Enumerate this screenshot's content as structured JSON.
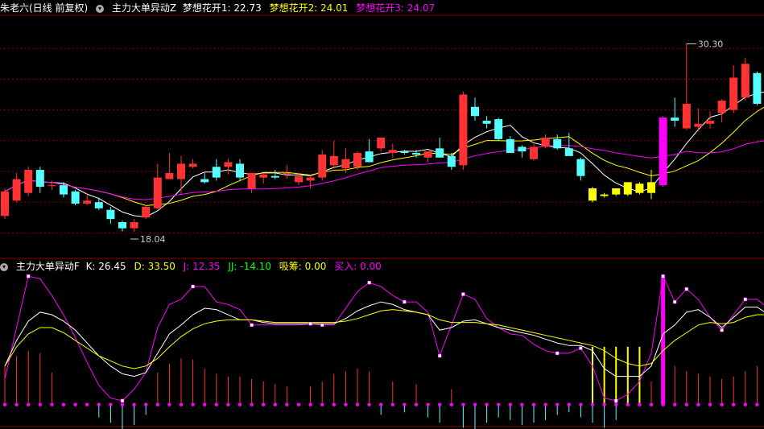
{
  "header": {
    "stock_name": "朱老六(日线 前复权)",
    "indicator1_name": "主力大单异动Z",
    "items": [
      {
        "label": "梦想花开1: 22.73",
        "color": "#ffffff"
      },
      {
        "label": "梦想花开2: 24.01",
        "color": "#ffff00"
      },
      {
        "label": "梦想花开3: 24.07",
        "color": "#ff00ff"
      }
    ]
  },
  "sub_header": {
    "indicator2_name": "主力大单异动F",
    "items": [
      {
        "label": "K: 26.45",
        "color": "#ffffff"
      },
      {
        "label": "D: 33.50",
        "color": "#ffff00"
      },
      {
        "label": "J: 12.35",
        "color": "#ff00ff"
      },
      {
        "label": "JJ: -14.10",
        "color": "#00ff00"
      },
      {
        "label": "吸筹: 0.00",
        "color": "#ffff00"
      },
      {
        "label": "买入: 0.00",
        "color": "#ff00ff"
      }
    ]
  },
  "colors": {
    "up": "#ff3333",
    "down": "#54ffff",
    "special_up": "#ff00ff",
    "special_down": "#ffff00",
    "grid": "#8b0000"
  },
  "chart_data": [
    {
      "type": "candlestick",
      "title": "朱老六(日线 前复权)",
      "ylim": [
        16.5,
        32.0
      ],
      "annotations": [
        {
          "text": "30.30",
          "value": 30.3
        },
        {
          "text": "18.04",
          "value": 18.04
        }
      ],
      "ohlc": [
        [
          19.1,
          20.9,
          18.9,
          20.7
        ],
        [
          20.1,
          21.9,
          20.0,
          21.5
        ],
        [
          20.6,
          22.3,
          20.4,
          22.1
        ],
        [
          22.1,
          22.3,
          20.6,
          21.0
        ],
        [
          21.1,
          21.4,
          20.8,
          21.1
        ],
        [
          21.1,
          21.3,
          20.3,
          20.5
        ],
        [
          20.7,
          20.8,
          19.8,
          19.9
        ],
        [
          19.9,
          20.6,
          19.8,
          20.1
        ],
        [
          20.0,
          20.3,
          19.5,
          19.6
        ],
        [
          19.5,
          19.7,
          18.6,
          18.9
        ],
        [
          18.7,
          18.8,
          18.1,
          18.3
        ],
        [
          18.3,
          18.9,
          18.1,
          18.7
        ],
        [
          19.0,
          19.8,
          18.9,
          19.7
        ],
        [
          19.6,
          22.5,
          19.5,
          21.6
        ],
        [
          21.5,
          23.2,
          21.5,
          21.9
        ],
        [
          21.5,
          23.0,
          20.5,
          22.5
        ],
        [
          22.3,
          22.8,
          22.2,
          22.5
        ],
        [
          21.5,
          21.9,
          21.2,
          21.3
        ],
        [
          22.3,
          22.8,
          21.4,
          21.6
        ],
        [
          22.3,
          22.8,
          21.8,
          22.6
        ],
        [
          22.5,
          22.8,
          21.4,
          21.6
        ],
        [
          20.9,
          21.9,
          20.6,
          21.9
        ],
        [
          21.6,
          21.9,
          21.2,
          21.8
        ],
        [
          21.7,
          22.1,
          21.5,
          21.6
        ],
        [
          21.8,
          22.4,
          21.5,
          21.9
        ],
        [
          21.3,
          21.9,
          21.1,
          21.7
        ],
        [
          21.4,
          21.8,
          20.9,
          21.6
        ],
        [
          21.6,
          23.4,
          21.4,
          23.1
        ],
        [
          22.4,
          24.0,
          22.2,
          23.0
        ],
        [
          22.2,
          23.5,
          21.9,
          22.8
        ],
        [
          22.3,
          23.3,
          22.1,
          23.2
        ],
        [
          23.3,
          24.1,
          22.6,
          22.6
        ],
        [
          23.5,
          24.1,
          23.3,
          24.2
        ],
        [
          23.2,
          23.8,
          22.9,
          23.4
        ],
        [
          23.3,
          23.4,
          23.1,
          23.2
        ],
        [
          23.2,
          23.4,
          22.9,
          23.1
        ],
        [
          22.9,
          23.3,
          22.6,
          23.3
        ],
        [
          23.5,
          24.2,
          22.9,
          22.9
        ],
        [
          23.0,
          23.2,
          22.1,
          22.3
        ],
        [
          22.4,
          27.2,
          22.1,
          27.0
        ],
        [
          26.2,
          26.8,
          25.3,
          25.6
        ],
        [
          25.3,
          25.6,
          24.8,
          25.1
        ],
        [
          25.4,
          25.5,
          24.0,
          24.1
        ],
        [
          24.1,
          24.3,
          23.2,
          23.2
        ],
        [
          23.6,
          23.7,
          22.9,
          23.3
        ],
        [
          22.8,
          23.8,
          22.7,
          23.6
        ],
        [
          23.6,
          24.4,
          23.5,
          24.2
        ],
        [
          24.1,
          24.4,
          23.4,
          23.5
        ],
        [
          23.5,
          24.5,
          23.1,
          23.0
        ],
        [
          22.8,
          22.9,
          21.4,
          21.7
        ],
        [
          20.9,
          21.0,
          20.0,
          20.1
        ],
        [
          20.4,
          20.6,
          20.3,
          20.5
        ],
        [
          20.5,
          20.9,
          20.4,
          20.9
        ],
        [
          20.5,
          21.3,
          20.4,
          21.3
        ],
        [
          21.2,
          21.3,
          20.5,
          20.6
        ],
        [
          20.6,
          22.1,
          20.2,
          21.3
        ],
        [
          21.1,
          25.6,
          21.0,
          25.5
        ],
        [
          25.5,
          26.8,
          24.9,
          25.3
        ],
        [
          24.8,
          30.3,
          24.7,
          26.4
        ],
        [
          24.9,
          26.1,
          24.6,
          25.1
        ],
        [
          25.1,
          25.9,
          24.8,
          25.3
        ],
        [
          25.8,
          26.7,
          25.2,
          26.6
        ],
        [
          26.0,
          28.9,
          25.8,
          28.1
        ],
        [
          26.8,
          29.4,
          26.6,
          29.0
        ],
        [
          28.4,
          28.5,
          26.3,
          26.4
        ],
        [
          26.6,
          26.9,
          25.6,
          26.1
        ],
        [
          25.9,
          26.7,
          25.4,
          25.9
        ]
      ],
      "special_up_index": 56,
      "special_down_indices": [
        50,
        51,
        52,
        53,
        54,
        55
      ],
      "series": [
        {
          "name": "梦想花开1",
          "color": "#ffffff"
        },
        {
          "name": "梦想花开2",
          "color": "#ffff00"
        },
        {
          "name": "梦想花开3",
          "color": "#ff00ff"
        }
      ]
    },
    {
      "type": "line",
      "title": "主力大单异动F",
      "ylim": [
        -14,
        102
      ],
      "zero_value": 0,
      "J": [
        20,
        60,
        100,
        98,
        85,
        70,
        52,
        33,
        15,
        5,
        3,
        12,
        25,
        60,
        78,
        82,
        92,
        92,
        80,
        78,
        74,
        62,
        62,
        62,
        62,
        62,
        63,
        62,
        62,
        75,
        88,
        95,
        92,
        85,
        80,
        80,
        72,
        38,
        62,
        86,
        82,
        67,
        60,
        55,
        54,
        47,
        42,
        40,
        40,
        44,
        30,
        5,
        3,
        8,
        18,
        40,
        100,
        80,
        90,
        82,
        68,
        58,
        70,
        82,
        82,
        75,
        70
      ],
      "K": [
        30,
        50,
        65,
        72,
        70,
        65,
        58,
        48,
        38,
        30,
        24,
        22,
        25,
        40,
        55,
        62,
        70,
        75,
        74,
        70,
        66,
        66,
        64,
        63,
        63,
        63,
        63,
        63,
        63,
        67,
        73,
        77,
        80,
        78,
        74,
        72,
        70,
        58,
        60,
        65,
        66,
        63,
        60,
        58,
        56,
        54,
        51,
        48,
        46,
        46,
        42,
        28,
        22,
        22,
        22,
        30,
        55,
        62,
        72,
        74,
        68,
        60,
        68,
        76,
        76,
        70,
        66
      ],
      "D": [
        30,
        45,
        55,
        60,
        60,
        56,
        50,
        44,
        38,
        34,
        30,
        28,
        30,
        36,
        45,
        53,
        59,
        63,
        65,
        66,
        66,
        66,
        65,
        64,
        64,
        64,
        64,
        64,
        64,
        65,
        67,
        70,
        73,
        74,
        73,
        72,
        70,
        66,
        64,
        64,
        64,
        63,
        62,
        60,
        58,
        56,
        54,
        52,
        50,
        48,
        46,
        42,
        36,
        32,
        30,
        32,
        42,
        50,
        56,
        62,
        64,
        63,
        64,
        68,
        70,
        70,
        68
      ],
      "up_bars": [
        0,
        1,
        2,
        3,
        4,
        13,
        14,
        15,
        16,
        17,
        18,
        19,
        20,
        21,
        22,
        23,
        24,
        26,
        27,
        28,
        29,
        30,
        31,
        33,
        35,
        38,
        53,
        54,
        55,
        56,
        57,
        58,
        59,
        60,
        61,
        62,
        63,
        64
      ],
      "up_bar_values": [
        30,
        38,
        42,
        40,
        25,
        25,
        32,
        36,
        35,
        28,
        24,
        22,
        22,
        20,
        18,
        16,
        14,
        14,
        18,
        24,
        26,
        28,
        26,
        18,
        16,
        12,
        14,
        16,
        18,
        24,
        30,
        26,
        24,
        22,
        20,
        22,
        26,
        30
      ],
      "down_bars": [
        8,
        9,
        10,
        11,
        12,
        32,
        34,
        36,
        37,
        39,
        40,
        41,
        42,
        43,
        44,
        45,
        46,
        47,
        48,
        49,
        50,
        51,
        52,
        65,
        66
      ],
      "down_bar_values": [
        -10,
        -14,
        -20,
        -16,
        -8,
        -8,
        -6,
        -10,
        -14,
        -18,
        -22,
        -14,
        -10,
        -12,
        -16,
        -14,
        -12,
        -8,
        -6,
        -10,
        -14,
        -18,
        -12,
        -6,
        -8
      ],
      "xichou_indices": [
        50,
        51,
        52,
        53,
        54
      ],
      "buy_index": 56
    }
  ]
}
